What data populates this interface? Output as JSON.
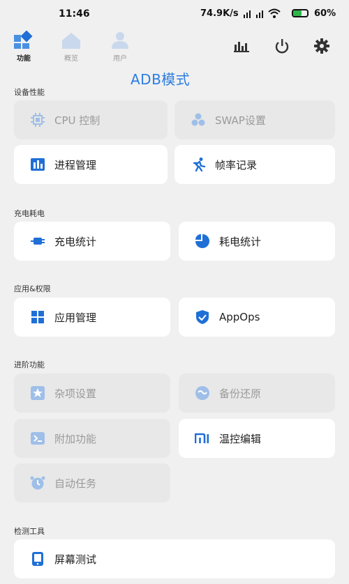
{
  "status": {
    "time": "11:46",
    "network_speed": "74.9K/s",
    "battery": "60%"
  },
  "tabs": [
    {
      "label": "功能",
      "icon": "tiles-icon",
      "active": true
    },
    {
      "label": "概览",
      "icon": "home-icon",
      "active": false
    },
    {
      "label": "用户",
      "icon": "user-icon",
      "active": false
    }
  ],
  "toolbar_icons": [
    "chart-icon",
    "power-icon",
    "gear-icon"
  ],
  "mode_label": "ADB模式",
  "sections": {
    "perf": "设备性能",
    "power": "充电耗电",
    "apps": "应用&权限",
    "advanced": "进阶功能",
    "tools": "检测工具"
  },
  "cards": {
    "cpu": "CPU 控制",
    "swap": "SWAP设置",
    "process": "进程管理",
    "fps": "帧率记录",
    "charge": "充电统计",
    "consume": "耗电统计",
    "appmgr": "应用管理",
    "appops": "AppOps",
    "misc": "杂项设置",
    "backup": "备份还原",
    "addon": "附加功能",
    "thermal": "温控编辑",
    "autotask": "自动任务",
    "screen": "屏幕测试"
  },
  "colors": {
    "accent": "#1f6fd6",
    "disabled_icon": "#9fbfe8",
    "mode_text": "#2b7de1"
  }
}
